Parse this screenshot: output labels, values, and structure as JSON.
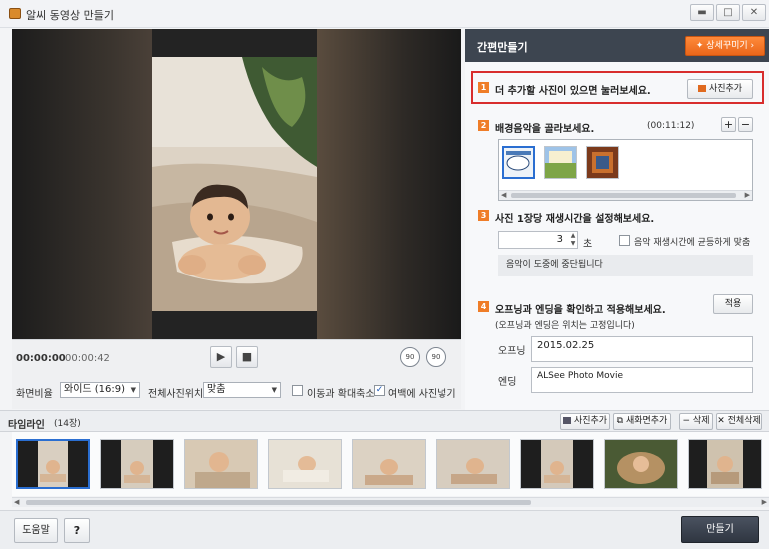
{
  "window": {
    "title": "알씨 동영상 만들기"
  },
  "player": {
    "time_current": "00:00:00",
    "time_total": "00:00:42"
  },
  "controls": {
    "aspect_label": "화면비율",
    "aspect_value": "와이드 (16:9)",
    "position_label": "전체사진위치",
    "position_value": "맞춤",
    "move_zoom_label": "이동과 확대축소",
    "margin_fill_label": "여백에 사진넣기"
  },
  "panel": {
    "header_title": "간편만들기",
    "detail_button": "상세꾸미기",
    "step1": {
      "num": "1",
      "title": "더 추가할 사진이 있으면 눌러보세요.",
      "button": "사진추가"
    },
    "step2": {
      "num": "2",
      "title": "배경음악을 골라보세요.",
      "duration": "(00:11:12)"
    },
    "step3": {
      "num": "3",
      "title": "사진 1장당 재생시간을 설정해보세요.",
      "seconds": "3",
      "unit": "초",
      "fit_label": "음악 재생시간에 균등하게 맞춤",
      "note": "음악이 도중에 중단됩니다"
    },
    "step4": {
      "num": "4",
      "title": "오프닝과 엔딩을 확인하고 적용해보세요.",
      "subtitle": "(오프닝과 엔딩은 위치는 고정입니다)",
      "apply_button": "적용",
      "opening_label": "오프닝",
      "opening_value": "2015.02.25",
      "ending_label": "엔딩",
      "ending_value": "ALSee Photo Movie"
    }
  },
  "timeline": {
    "label": "타임라인",
    "count": "(14장)",
    "add_photo": "사진추가",
    "new_screen": "새화면추가",
    "delete": "삭제",
    "delete_all": "전체삭제"
  },
  "footer": {
    "help_button": "도움말",
    "question_button": "?",
    "make_button": "만들기"
  },
  "colors": {
    "accent_orange": "#ef7d28",
    "header_dark": "#3d4550",
    "highlight_red": "#d82d2d",
    "selection_blue": "#2a6ed1"
  }
}
